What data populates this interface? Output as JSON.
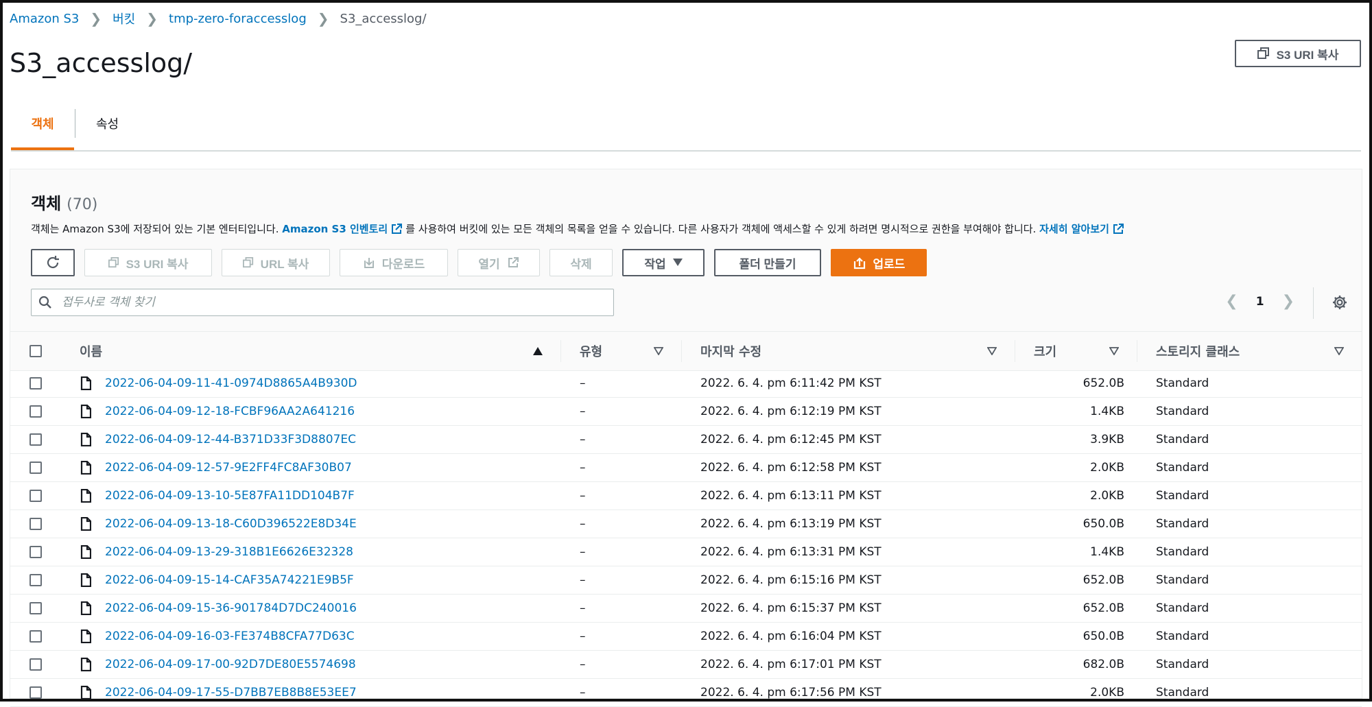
{
  "breadcrumb": {
    "items": [
      "Amazon S3",
      "버킷",
      "tmp-zero-foraccesslog"
    ],
    "current": "S3_accesslog/"
  },
  "page": {
    "title": "S3_accesslog/",
    "copy_uri_label": "S3 URI 복사"
  },
  "tabs": [
    {
      "label": "객체",
      "active": true
    },
    {
      "label": "속성",
      "active": false
    }
  ],
  "objects_panel": {
    "title": "객체",
    "count": "(70)",
    "description_before": "객체는 Amazon S3에 저장되어 있는 기본 엔터티입니다.",
    "inventory_link": "Amazon S3 인벤토리",
    "description_after": "를 사용하여 버킷에 있는 모든 객체의 목록을 얻을 수 있습니다. 다른 사용자가 객체에 액세스할 수 있게 하려면 명시적으로 권한을 부여해야 합니다.",
    "learn_more": "자세히 알아보기"
  },
  "actions": {
    "copy_s3_uri": "S3 URI 복사",
    "copy_url": "URL 복사",
    "download": "다운로드",
    "open": "열기",
    "delete": "삭제",
    "actions_menu": "작업",
    "create_folder": "폴더 만들기",
    "upload": "업로드"
  },
  "search": {
    "placeholder": "접두사로 객체 찾기"
  },
  "pagination": {
    "current_page": "1"
  },
  "colors": {
    "accent": "#ec7211",
    "link": "#0073bb"
  },
  "table": {
    "columns": [
      "이름",
      "유형",
      "마지막 수정",
      "크기",
      "스토리지 클래스"
    ],
    "rows": [
      {
        "name": "2022-06-04-09-11-41-0974D8865A4B930D",
        "type": "–",
        "modified": "2022. 6. 4. pm 6:11:42 PM KST",
        "size": "652.0B",
        "storage": "Standard"
      },
      {
        "name": "2022-06-04-09-12-18-FCBF96AA2A641216",
        "type": "–",
        "modified": "2022. 6. 4. pm 6:12:19 PM KST",
        "size": "1.4KB",
        "storage": "Standard"
      },
      {
        "name": "2022-06-04-09-12-44-B371D33F3D8807EC",
        "type": "–",
        "modified": "2022. 6. 4. pm 6:12:45 PM KST",
        "size": "3.9KB",
        "storage": "Standard"
      },
      {
        "name": "2022-06-04-09-12-57-9E2FF4FC8AF30B07",
        "type": "–",
        "modified": "2022. 6. 4. pm 6:12:58 PM KST",
        "size": "2.0KB",
        "storage": "Standard"
      },
      {
        "name": "2022-06-04-09-13-10-5E87FA11DD104B7F",
        "type": "–",
        "modified": "2022. 6. 4. pm 6:13:11 PM KST",
        "size": "2.0KB",
        "storage": "Standard"
      },
      {
        "name": "2022-06-04-09-13-18-C60D396522E8D34E",
        "type": "–",
        "modified": "2022. 6. 4. pm 6:13:19 PM KST",
        "size": "650.0B",
        "storage": "Standard"
      },
      {
        "name": "2022-06-04-09-13-29-318B1E6626E32328",
        "type": "–",
        "modified": "2022. 6. 4. pm 6:13:31 PM KST",
        "size": "1.4KB",
        "storage": "Standard"
      },
      {
        "name": "2022-06-04-09-15-14-CAF35A74221E9B5F",
        "type": "–",
        "modified": "2022. 6. 4. pm 6:15:16 PM KST",
        "size": "652.0B",
        "storage": "Standard"
      },
      {
        "name": "2022-06-04-09-15-36-901784D7DC240016",
        "type": "–",
        "modified": "2022. 6. 4. pm 6:15:37 PM KST",
        "size": "652.0B",
        "storage": "Standard"
      },
      {
        "name": "2022-06-04-09-16-03-FE374B8CFA77D63C",
        "type": "–",
        "modified": "2022. 6. 4. pm 6:16:04 PM KST",
        "size": "650.0B",
        "storage": "Standard"
      },
      {
        "name": "2022-06-04-09-17-00-92D7DE80E5574698",
        "type": "–",
        "modified": "2022. 6. 4. pm 6:17:01 PM KST",
        "size": "682.0B",
        "storage": "Standard"
      },
      {
        "name": "2022-06-04-09-17-55-D7BB7EB8B8E53EE7",
        "type": "–",
        "modified": "2022. 6. 4. pm 6:17:56 PM KST",
        "size": "2.0KB",
        "storage": "Standard"
      }
    ]
  }
}
